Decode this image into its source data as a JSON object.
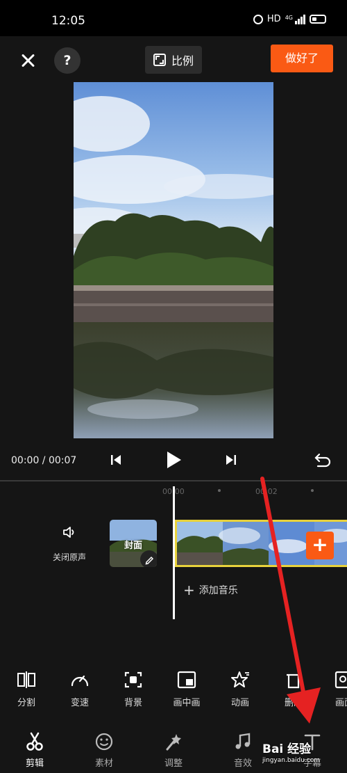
{
  "status_bar": {
    "time": "12:05",
    "network": "HD",
    "signal_label": "4G"
  },
  "top_bar": {
    "ratio_label": "比例",
    "done_label": "做好了"
  },
  "player": {
    "timecode": "00:00 / 00:07"
  },
  "timeline": {
    "ticks": [
      "00:00",
      "00:02"
    ],
    "mute_label": "关闭原声",
    "cover_label": "封面",
    "add_music_label": "添加音乐",
    "add_clip_symbol": "+"
  },
  "toolbar": {
    "items": [
      {
        "label": "分割",
        "icon": "split-icon"
      },
      {
        "label": "变速",
        "icon": "speed-icon"
      },
      {
        "label": "背景",
        "icon": "background-icon"
      },
      {
        "label": "画中画",
        "icon": "picture-in-picture-icon"
      },
      {
        "label": "动画",
        "icon": "animation-icon"
      },
      {
        "label": "删除",
        "icon": "delete-icon"
      },
      {
        "label": "画面",
        "icon": "frame-icon"
      }
    ]
  },
  "tabs": [
    {
      "label": "剪辑",
      "icon": "scissors-icon",
      "active": true
    },
    {
      "label": "素材",
      "icon": "sticker-icon",
      "active": false
    },
    {
      "label": "调整",
      "icon": "adjust-icon",
      "active": false
    },
    {
      "label": "音效",
      "icon": "music-note-icon",
      "active": false
    },
    {
      "label": "字幕",
      "icon": "text-icon",
      "active": false
    }
  ],
  "watermark": {
    "brand": "Bai 经验",
    "url": "jingyan.baidu.com"
  },
  "colors": {
    "accent": "#fa5a14",
    "clip_border": "#e8d23c",
    "annotation_arrow": "#e52222"
  }
}
